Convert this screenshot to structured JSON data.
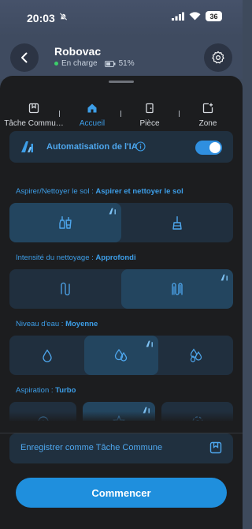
{
  "status_bar": {
    "time": "20:03",
    "battery": "36"
  },
  "header": {
    "device_name": "Robovac",
    "status_text": "En charge",
    "battery_percent": "51%"
  },
  "tabs": [
    {
      "label": "Tâche Commu…",
      "icon": "shared-task-icon",
      "active": false
    },
    {
      "label": "Accueil",
      "icon": "home-icon",
      "active": true
    },
    {
      "label": "Pièce",
      "icon": "room-door-icon",
      "active": false
    },
    {
      "label": "Zone",
      "icon": "zone-add-icon",
      "active": false
    }
  ],
  "ai_automation": {
    "label": "Automatisation de l'IA",
    "enabled": true
  },
  "sections": {
    "clean_mode": {
      "label": "Aspirer/Nettoyer le sol :",
      "value": "Aspirer et nettoyer le sol",
      "options": [
        "vacuum-and-mop-icon",
        "mop-only-icon"
      ],
      "selected": 0
    },
    "intensity": {
      "label": "Intensité du nettoyage :",
      "value": "Approfondi",
      "options": [
        "standard-route-icon",
        "deep-route-icon"
      ],
      "selected": 1
    },
    "water_level": {
      "label": "Niveau d'eau :",
      "value": "Moyenne",
      "options": [
        "water-low-icon",
        "water-medium-icon",
        "water-high-icon"
      ],
      "selected": 1
    },
    "suction": {
      "label": "Aspiration :",
      "value": "Turbo",
      "options": [
        "suction-quiet-icon",
        "suction-turbo-icon",
        "suction-max-icon"
      ],
      "selected": 1
    }
  },
  "save_task": {
    "label": "Enregistrer comme Tâche Commune"
  },
  "start_button": {
    "label": "Commencer"
  },
  "colors": {
    "accent": "#2f8fe0",
    "background": "#1c1d1f",
    "card": "#202f3e",
    "selected": "#23455f",
    "charging": "#3ccf6a"
  }
}
